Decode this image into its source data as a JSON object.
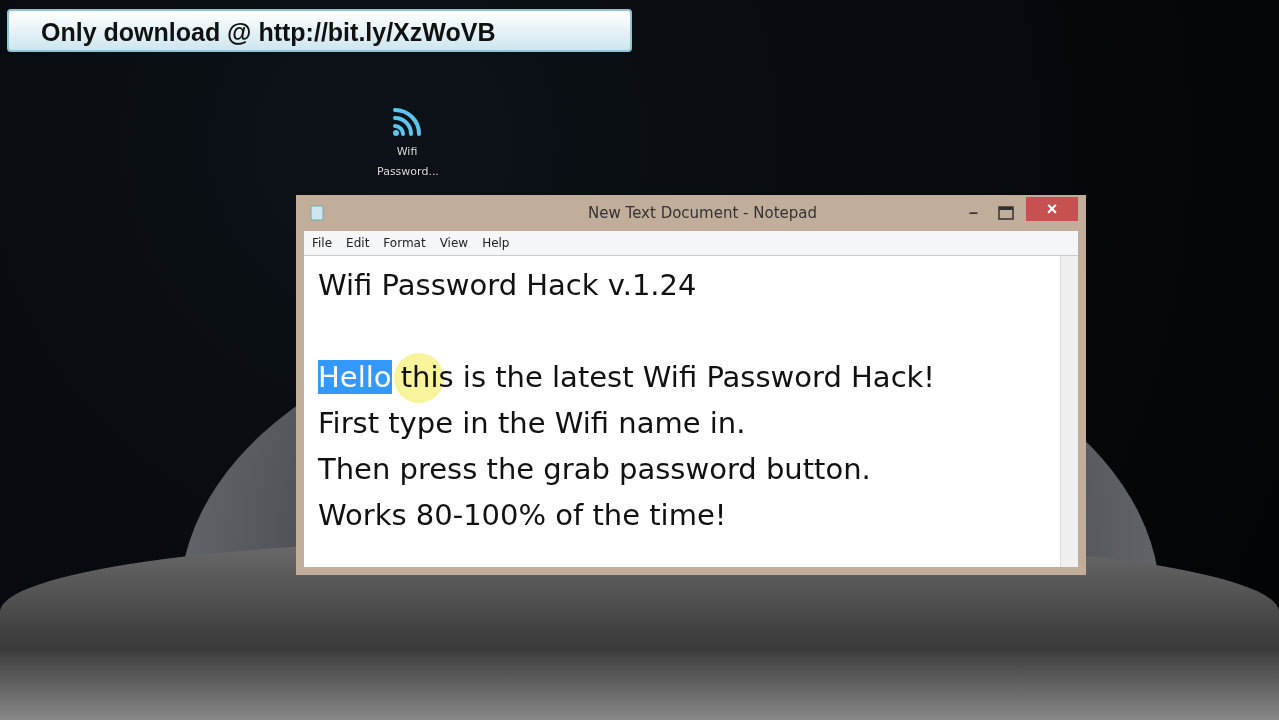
{
  "banner": {
    "text": "Only download @ http://bit.ly/XzWoVB"
  },
  "desktop_icons": [
    {
      "label": "Wifi Password..."
    }
  ],
  "window": {
    "title": "New Text Document - Notepad",
    "minimize": "–",
    "close": "×",
    "menu": [
      "File",
      "Edit",
      "Format",
      "View",
      "Help"
    ],
    "document": {
      "heading": "Wifi Password Hack v.1.24",
      "lines": [
        {
          "segments": [
            {
              "text": "Hello",
              "selected": true
            },
            {
              "text": " this is the latest Wifi Password Hack!",
              "selected": false
            }
          ]
        },
        {
          "segments": [
            {
              "text": "First type in the Wifi name in.",
              "selected": false
            }
          ]
        },
        {
          "segments": [
            {
              "text": "Then press the grab password button.",
              "selected": false
            }
          ]
        },
        {
          "segments": [
            {
              "text": "Works 80-100% of the time!",
              "selected": false
            }
          ]
        }
      ]
    }
  }
}
